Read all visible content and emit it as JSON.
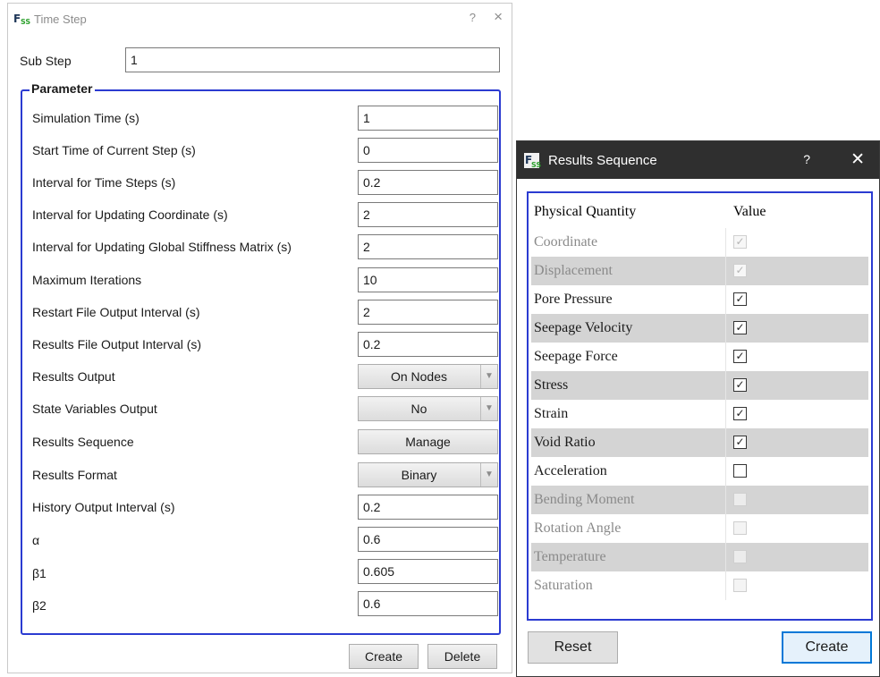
{
  "time_step": {
    "title": "Time Step",
    "help": "?",
    "close": "×",
    "substep": {
      "label": "Sub Step",
      "value": "1"
    },
    "group_title": "Parameter",
    "rows": [
      {
        "label": "Simulation Time (s)",
        "value": "1"
      },
      {
        "label": "Start Time of Current Step (s)",
        "value": "0"
      },
      {
        "label": "Interval for Time Steps (s)",
        "value": "0.2"
      },
      {
        "label": "Interval for Updating Coordinate (s)",
        "value": "2"
      },
      {
        "label": "Interval for Updating Global Stiffness Matrix (s)",
        "value": "2"
      },
      {
        "label": "Maximum Iterations",
        "value": "10"
      },
      {
        "label": "Restart File Output Interval (s)",
        "value": "2"
      },
      {
        "label": "Results File Output Interval (s)",
        "value": "0.2"
      },
      {
        "label": "Results Output",
        "value": "On Nodes"
      },
      {
        "label": "State Variables Output",
        "value": "No"
      },
      {
        "label": "Results Sequence",
        "value": "Manage"
      },
      {
        "label": "Results Format",
        "value": "Binary"
      },
      {
        "label": "History Output Interval (s)",
        "value": "0.2"
      },
      {
        "label": "α",
        "value": "0.6"
      },
      {
        "label": "β1",
        "value": "0.605"
      },
      {
        "label": "β2",
        "value": "0.6"
      }
    ],
    "create_label": "Create",
    "delete_label": "Delete"
  },
  "results_sequence": {
    "title": "Results Sequence",
    "help": "?",
    "close": "✕",
    "header": {
      "quantity": "Physical Quantity",
      "value": "Value"
    },
    "rows": [
      {
        "name": "Coordinate",
        "checked": true,
        "enabled": false,
        "mark": "✓"
      },
      {
        "name": "Displacement",
        "checked": true,
        "enabled": false,
        "mark": "✓"
      },
      {
        "name": "Pore Pressure",
        "checked": true,
        "enabled": true,
        "mark": "✓"
      },
      {
        "name": "Seepage Velocity",
        "checked": true,
        "enabled": true,
        "mark": "✓"
      },
      {
        "name": "Seepage Force",
        "checked": true,
        "enabled": true,
        "mark": "✓"
      },
      {
        "name": "Stress",
        "checked": true,
        "enabled": true,
        "mark": "✓"
      },
      {
        "name": "Strain",
        "checked": true,
        "enabled": true,
        "mark": "✓"
      },
      {
        "name": "Void Ratio",
        "checked": true,
        "enabled": true,
        "mark": "✓"
      },
      {
        "name": "Acceleration",
        "checked": false,
        "enabled": true,
        "mark": ""
      },
      {
        "name": "Bending Moment",
        "checked": false,
        "enabled": false,
        "mark": ""
      },
      {
        "name": "Rotation Angle",
        "checked": false,
        "enabled": false,
        "mark": ""
      },
      {
        "name": "Temperature",
        "checked": false,
        "enabled": false,
        "mark": ""
      },
      {
        "name": "Saturation",
        "checked": false,
        "enabled": false,
        "mark": ""
      }
    ],
    "reset_label": "Reset",
    "create_label": "Create"
  },
  "icons": {
    "app": "fss-app-icon",
    "combo_arrow": "chevron-down-icon",
    "check": "check-icon"
  },
  "colors": {
    "group_border": "#2b3bd1",
    "focus_border": "#0078d7",
    "dark_titlebar": "#2f2f2f",
    "alt_row": "#d4d4d4"
  }
}
